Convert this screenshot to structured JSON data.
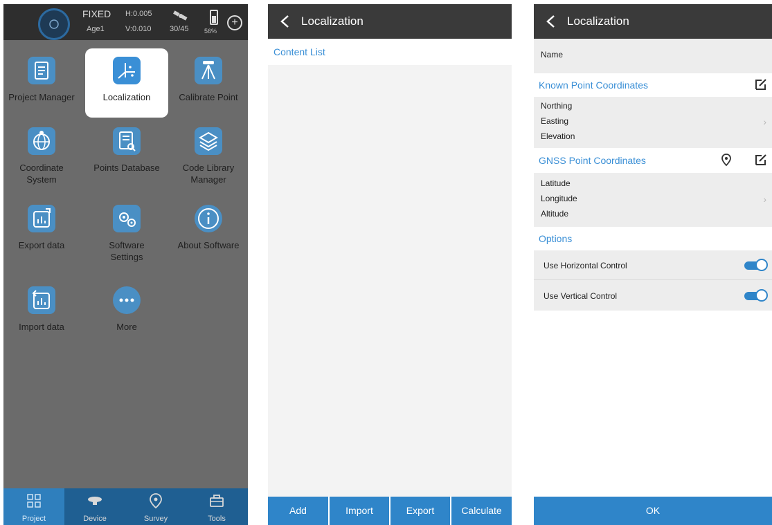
{
  "status": {
    "fix": "FIXED",
    "age": "Age1",
    "h_precision": "H:0.005",
    "v_precision": "V:0.010",
    "satellites": "30/45",
    "battery": "56%"
  },
  "grid": [
    {
      "label": "Project Manager",
      "icon": "clipboard-icon"
    },
    {
      "label": "Localization",
      "icon": "axes-icon"
    },
    {
      "label": "Calibrate Point",
      "icon": "tripod-icon"
    },
    {
      "label": "Coordinate\nSystem",
      "icon": "globe-icon"
    },
    {
      "label": "Points Database",
      "icon": "database-search-icon"
    },
    {
      "label": "Code Library\nManager",
      "icon": "layers-icon"
    },
    {
      "label": "Export data",
      "icon": "export-chart-icon"
    },
    {
      "label": "Software\nSettings",
      "icon": "gears-icon"
    },
    {
      "label": "About Software",
      "icon": "info-icon"
    },
    {
      "label": "Import data",
      "icon": "import-chart-icon"
    },
    {
      "label": "More",
      "icon": "more-icon"
    }
  ],
  "tabs": [
    {
      "label": "Project",
      "icon": "grid-icon"
    },
    {
      "label": "Device",
      "icon": "receiver-icon"
    },
    {
      "label": "Survey",
      "icon": "pin-icon"
    },
    {
      "label": "Tools",
      "icon": "toolbox-icon"
    }
  ],
  "loc_list": {
    "title": "Localization",
    "content_list": "Content List",
    "buttons": [
      "Add",
      "Import",
      "Export",
      "Calculate"
    ]
  },
  "loc_detail": {
    "title": "Localization",
    "name_label": "Name",
    "known_header": "Known Point Coordinates",
    "known_fields": [
      "Northing",
      "Easting",
      "Elevation"
    ],
    "gnss_header": "GNSS Point Coordinates",
    "gnss_fields": [
      "Latitude",
      "Longitude",
      "Altitude"
    ],
    "options_header": "Options",
    "use_horizontal": "Use Horizontal Control",
    "use_vertical": "Use Vertical Control",
    "ok": "OK"
  },
  "colors": {
    "accent": "#2f85c9",
    "link": "#3a8fd6",
    "dark_bar": "#3a3a3a"
  }
}
